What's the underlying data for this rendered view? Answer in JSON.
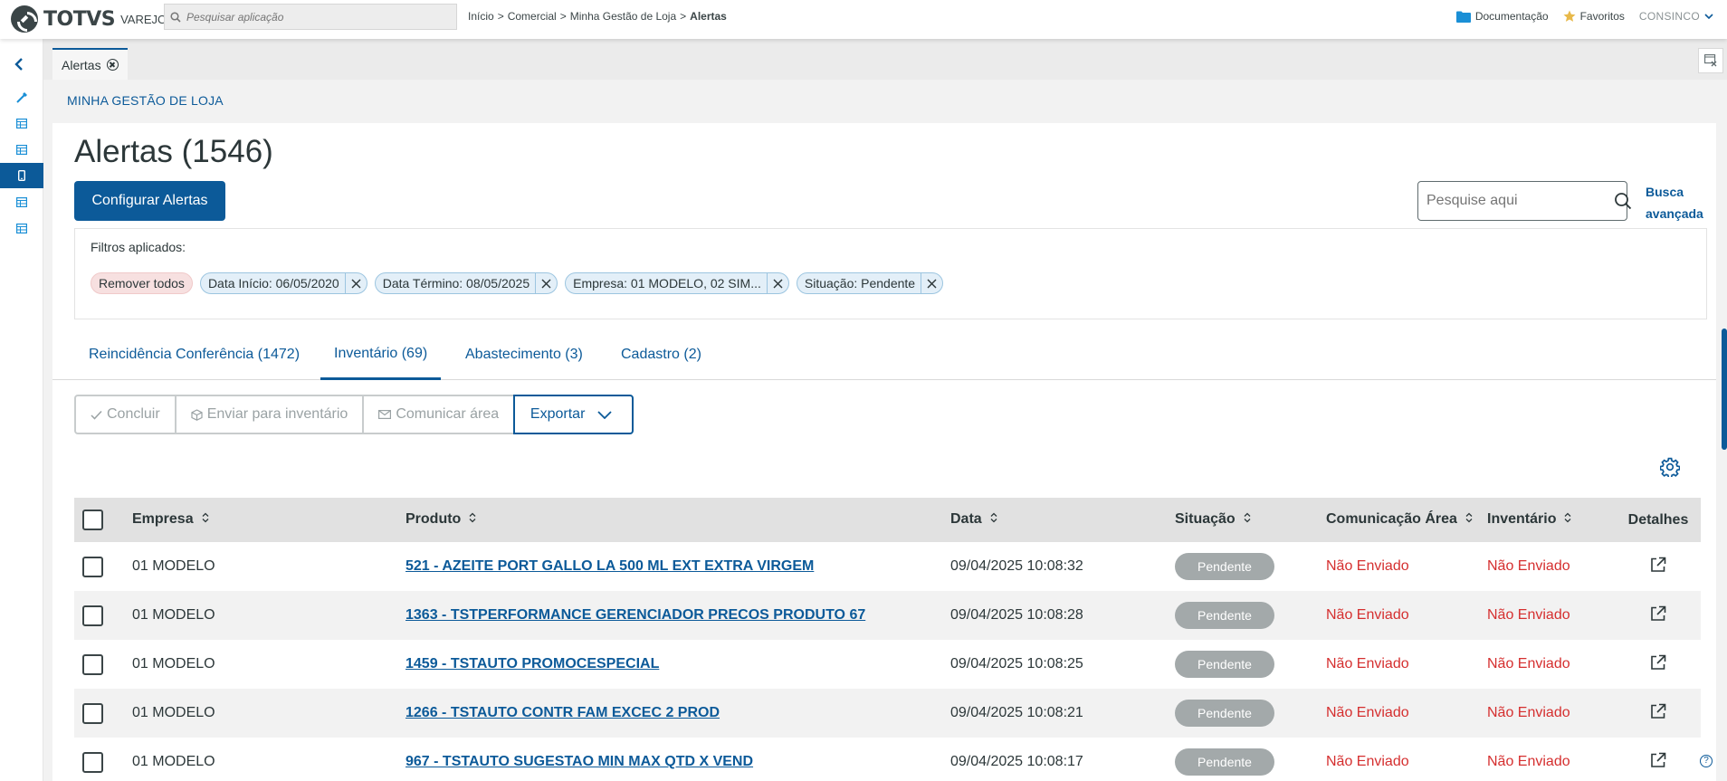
{
  "topbar": {
    "logo_text": "TOTVS",
    "logo_sub": "VAREJO",
    "search_placeholder": "Pesquisar aplicação",
    "breadcrumb": [
      "Início",
      "Comercial",
      "Minha Gestão de Loja",
      "Alertas"
    ],
    "breadcrumb_sep": ">",
    "documentation": "Documentação",
    "favorites": "Favoritos",
    "user": "CONSINCO"
  },
  "tab": {
    "label": "Alertas"
  },
  "page": {
    "module": "MINHA GESTÃO DE LOJA",
    "title": "Alertas (1546)",
    "configure_button": "Configurar Alertas",
    "search_placeholder": "Pesquise aqui",
    "advanced_search": "Busca avançada"
  },
  "filters": {
    "label": "Filtros aplicados:",
    "remove_all": "Remover todos",
    "chips": [
      "Data Início: 06/05/2020",
      "Data Término: 08/05/2025",
      "Empresa: 01 MODELO, 02 SIM...",
      "Situação: Pendente"
    ]
  },
  "tabs": [
    {
      "label": "Reincidência Conferência (1472)"
    },
    {
      "label": "Inventário (69)"
    },
    {
      "label": "Abastecimento (3)"
    },
    {
      "label": "Cadastro (2)"
    }
  ],
  "actions": {
    "conclude": "Concluir",
    "send_inventory": "Enviar para inventário",
    "communicate": "Comunicar área",
    "export": "Exportar"
  },
  "table": {
    "headers": {
      "empresa": "Empresa",
      "produto": "Produto",
      "data": "Data",
      "situacao": "Situação",
      "comunicacao": "Comunicação Área",
      "inventario": "Inventário",
      "detalhes": "Detalhes"
    },
    "rows": [
      {
        "empresa": "01 MODELO",
        "produto": "521 - AZEITE PORT GALLO LA 500 ML EXT EXTRA VIRGEM",
        "data": "09/04/2025 10:08:32",
        "situacao": "Pendente",
        "comunicacao": "Não Enviado",
        "inventario": "Não Enviado"
      },
      {
        "empresa": "01 MODELO",
        "produto": "1363 - TSTPERFORMANCE GERENCIADOR PRECOS PRODUTO 67",
        "data": "09/04/2025 10:08:28",
        "situacao": "Pendente",
        "comunicacao": "Não Enviado",
        "inventario": "Não Enviado"
      },
      {
        "empresa": "01 MODELO",
        "produto": "1459 - TSTAUTO PROMOCESPECIAL",
        "data": "09/04/2025 10:08:25",
        "situacao": "Pendente",
        "comunicacao": "Não Enviado",
        "inventario": "Não Enviado"
      },
      {
        "empresa": "01 MODELO",
        "produto": "1266 - TSTAUTO CONTR FAM EXCEC 2 PROD",
        "data": "09/04/2025 10:08:21",
        "situacao": "Pendente",
        "comunicacao": "Não Enviado",
        "inventario": "Não Enviado"
      },
      {
        "empresa": "01 MODELO",
        "produto": "967 - TSTAUTO SUGESTAO MIN MAX QTD X VEND",
        "data": "09/04/2025 10:08:17",
        "situacao": "Pendente",
        "comunicacao": "Não Enviado",
        "inventario": "Não Enviado"
      }
    ]
  },
  "help": "?",
  "colors": {
    "primary": "#0c5a99",
    "danger": "#d52f2f",
    "badge": "#a3a9aa"
  }
}
